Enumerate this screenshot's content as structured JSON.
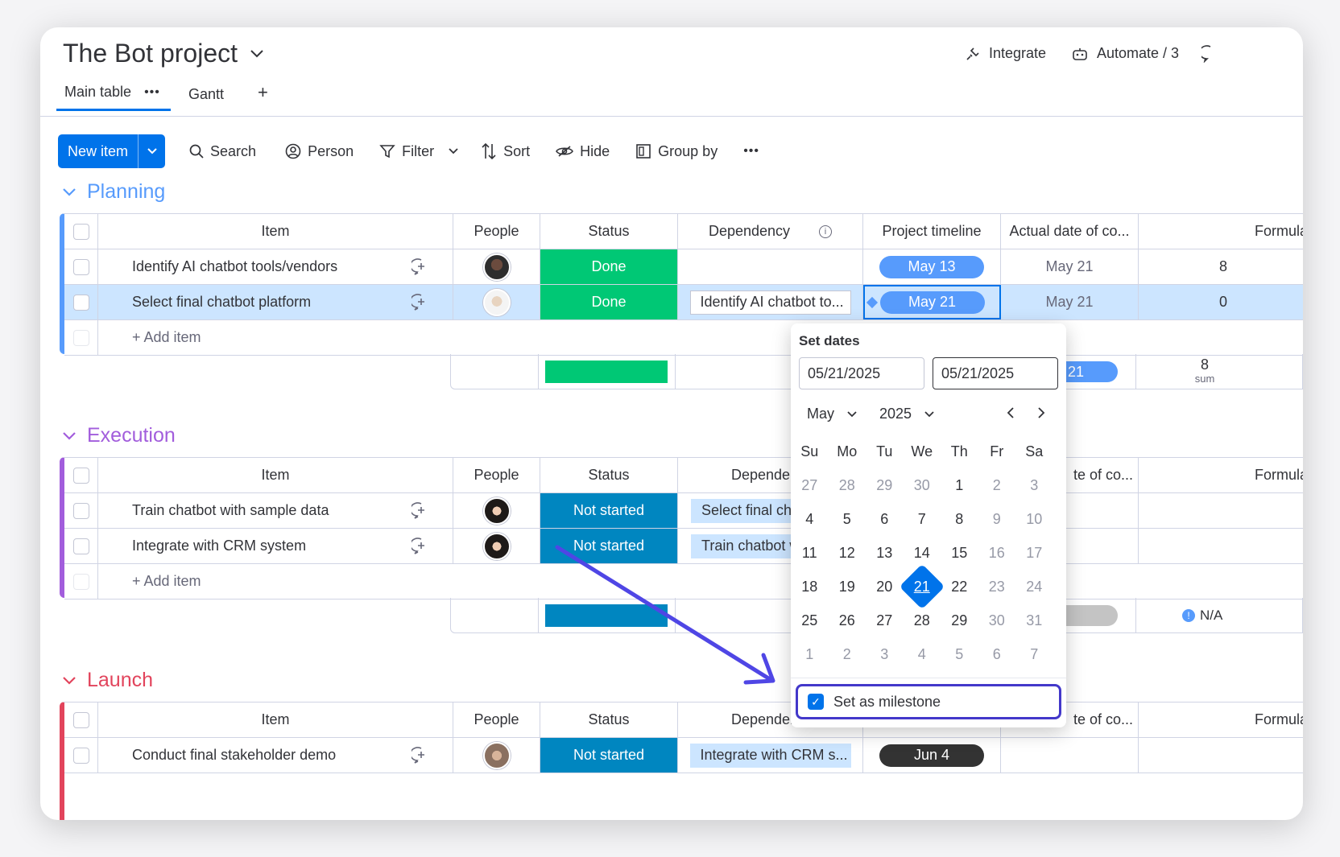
{
  "header": {
    "title": "The Bot project",
    "integrate_label": "Integrate",
    "automate_label": "Automate / 3"
  },
  "tabs": [
    {
      "label": "Main table"
    },
    {
      "label": "Gantt"
    }
  ],
  "tab_add": "+",
  "toolbar": {
    "new_item": "New item",
    "search": "Search",
    "person": "Person",
    "filter": "Filter",
    "sort": "Sort",
    "hide": "Hide",
    "group_by": "Group by"
  },
  "columns": {
    "item": "Item",
    "people": "People",
    "status": "Status",
    "dependency": "Dependency",
    "dependency_trunc": "Dependen",
    "timeline": "Project timeline",
    "actual": "Actual date of co...",
    "actual_trunc": "te of co...",
    "formula": "Formula"
  },
  "groups": {
    "planning": {
      "name": "Planning",
      "color": "#579bfc",
      "rows": [
        {
          "item": "Identify AI chatbot tools/vendors",
          "status": "Done",
          "dependency": "",
          "timeline": "May 13",
          "actual": "May 21",
          "formula": "8"
        },
        {
          "item": "Select final chatbot platform",
          "status": "Done",
          "dependency": "Identify AI chatbot to...",
          "timeline": "May 21",
          "actual": "May 21",
          "formula": "0"
        }
      ],
      "add_item": "+ Add item",
      "summary_timeline": "21",
      "summary_sum": "8",
      "summary_sum_label": "sum"
    },
    "execution": {
      "name": "Execution",
      "color": "#a25ddc",
      "rows": [
        {
          "item": "Train chatbot with sample data",
          "status": "Not started",
          "dependency": "Select final cha"
        },
        {
          "item": "Integrate with CRM system",
          "status": "Not started",
          "dependency": "Train chatbot w"
        }
      ],
      "add_item": "+ Add item",
      "summary_formula": "N/A"
    },
    "launch": {
      "name": "Launch",
      "color": "#e2445c",
      "rows": [
        {
          "item": "Conduct final stakeholder demo",
          "status": "Not started",
          "dependency": "Integrate with CRM s...",
          "timeline": "Jun 4"
        }
      ]
    }
  },
  "datepicker": {
    "title": "Set dates",
    "start": "05/21/2025",
    "end": "05/21/2025",
    "month": "May",
    "year": "2025",
    "weekdays": [
      "Su",
      "Mo",
      "Tu",
      "We",
      "Th",
      "Fr",
      "Sa"
    ],
    "weeks": [
      [
        "27",
        "28",
        "29",
        "30",
        "1",
        "2",
        "3"
      ],
      [
        "4",
        "5",
        "6",
        "7",
        "8",
        "9",
        "10"
      ],
      [
        "11",
        "12",
        "13",
        "14",
        "15",
        "16",
        "17"
      ],
      [
        "18",
        "19",
        "20",
        "21",
        "22",
        "23",
        "24"
      ],
      [
        "25",
        "26",
        "27",
        "28",
        "29",
        "30",
        "31"
      ],
      [
        "1",
        "2",
        "3",
        "4",
        "5",
        "6",
        "7"
      ]
    ],
    "milestone_label": "Set as milestone"
  },
  "colors": {
    "done": "#00c875",
    "not_started": "#0086c0",
    "accent": "#0073ea",
    "arrow": "#4f46e5"
  }
}
